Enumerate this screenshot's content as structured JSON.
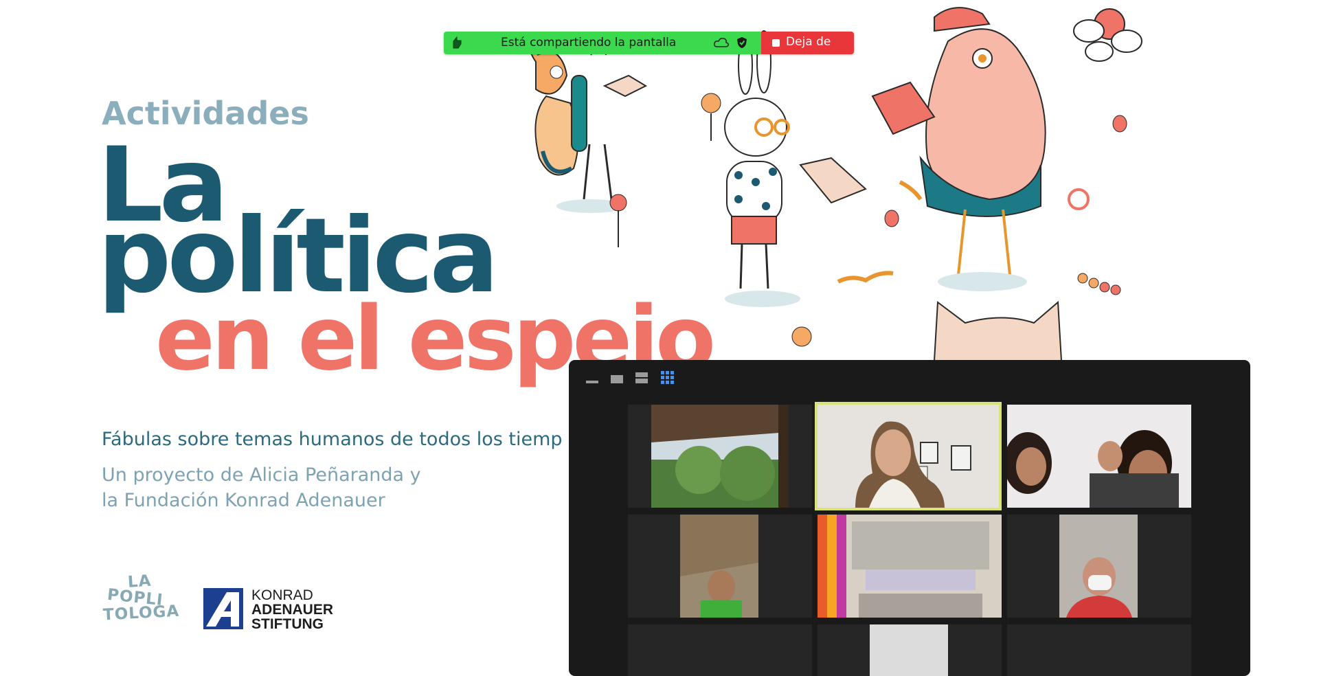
{
  "slide": {
    "kicker": "Actividades",
    "title_line1": "La",
    "title_line2": "política",
    "title_line3": "en el espejo",
    "subtitle": "Fábulas sobre temas humanos de todos los tiemp",
    "credit_line1": "Un proyecto de Alicia Peñaranda y",
    "credit_line2": "la Fundación Konrad Adenauer",
    "logo_poplitologa": [
      "LA",
      "POPLI",
      "TOLOGA"
    ],
    "logo_kas": [
      "KONRAD",
      "ADENAUER",
      "STIFTUNG"
    ]
  },
  "share_bar": {
    "status_text": "Está compartiendo la pantalla",
    "stop_label": "Deja de",
    "icons": [
      "hand-pointer-icon",
      "cloud-record-icon",
      "shield-check-icon",
      "stop-square-icon"
    ],
    "colors": {
      "green": "#3ad94e",
      "red": "#e8363a"
    }
  },
  "zoom_window": {
    "view_icons": [
      "minimize-view-icon",
      "thumbnail-view-icon",
      "speaker-view-icon",
      "gallery-view-icon"
    ],
    "active_view": "gallery-view-icon",
    "active_speaker_color": "#d9e37a"
  },
  "colors": {
    "title_blue": "#1b5a71",
    "title_coral": "#ef7467",
    "kicker": "#8aaebb"
  }
}
